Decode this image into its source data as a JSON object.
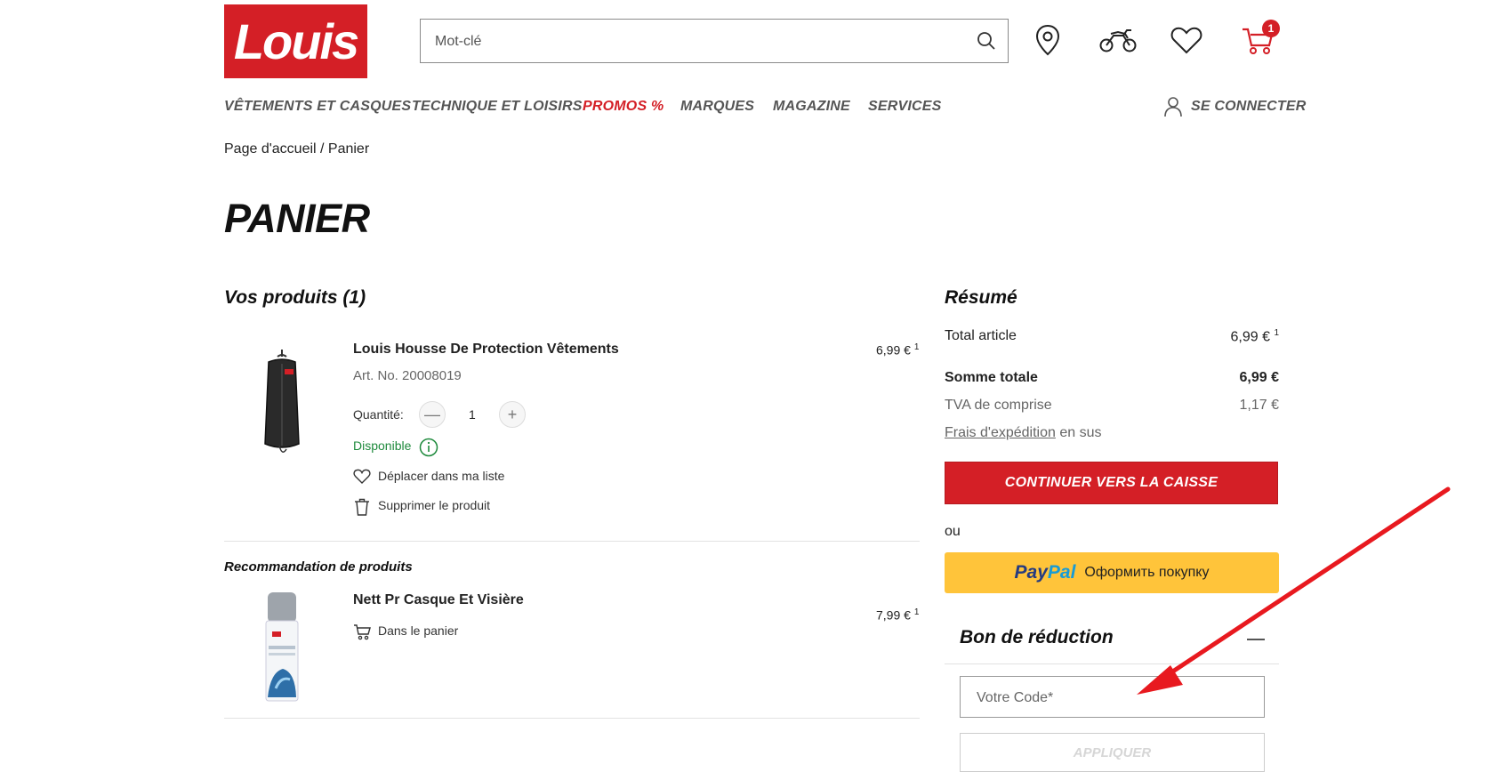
{
  "header": {
    "logo_text": "Louis",
    "search": {
      "placeholder": "Mot-clé"
    },
    "icons": [
      "store-locator-icon",
      "motorcycle-icon",
      "wishlist-heart-icon",
      "cart-icon"
    ],
    "cart_count": "1"
  },
  "nav": {
    "items": [
      "VÊTEMENTS ET CASQUES",
      "TECHNIQUE ET LOISIRS",
      "PROMOS %",
      "MARQUES",
      "MAGAZINE",
      "SERVICES"
    ],
    "login": "SE CONNECTER"
  },
  "breadcrumb": "Page d'accueil / Panier",
  "page_title": "PANIER",
  "products": {
    "heading": "Vos produits (1)",
    "item": {
      "name": "Louis Housse De Protection Vêtements",
      "art_no": "Art. No. 20008019",
      "price": "6,99 €",
      "price_note": "1",
      "qty_label": "Quantité:",
      "qty": "1",
      "availability": "Disponible",
      "move_to_list": "Déplacer dans ma liste",
      "remove": "Supprimer le produit"
    }
  },
  "recommendation": {
    "heading": "Recommandation de produits",
    "item": {
      "name": "Nett Pr Casque Et Visière",
      "price": "7,99 €",
      "price_note": "1",
      "add_to_cart": "Dans le panier"
    }
  },
  "summary": {
    "heading": "Résumé",
    "total_article_label": "Total article",
    "total_article_value": "6,99 €",
    "total_article_note": "1",
    "grand_total_label": "Somme totale",
    "grand_total_value": "6,99 €",
    "vat_label": "TVA de comprise",
    "vat_value": "1,17 €",
    "shipping_link": "Frais d'expédition",
    "shipping_suffix": "en sus",
    "checkout_button": "CONTINUER VERS LA CAISSE",
    "or": "ou",
    "paypal_brand_1": "Pay",
    "paypal_brand_2": "Pal",
    "paypal_text": "Оформить покупку"
  },
  "coupon": {
    "heading": "Bon de réduction",
    "placeholder": "Votre Code*",
    "apply_button": "APPLIQUER"
  },
  "colors": {
    "brand_red": "#d41f26",
    "paypal_yellow": "#ffc43a",
    "available_green": "#1e8a3c",
    "annotation_arrow": "#e8191f"
  }
}
